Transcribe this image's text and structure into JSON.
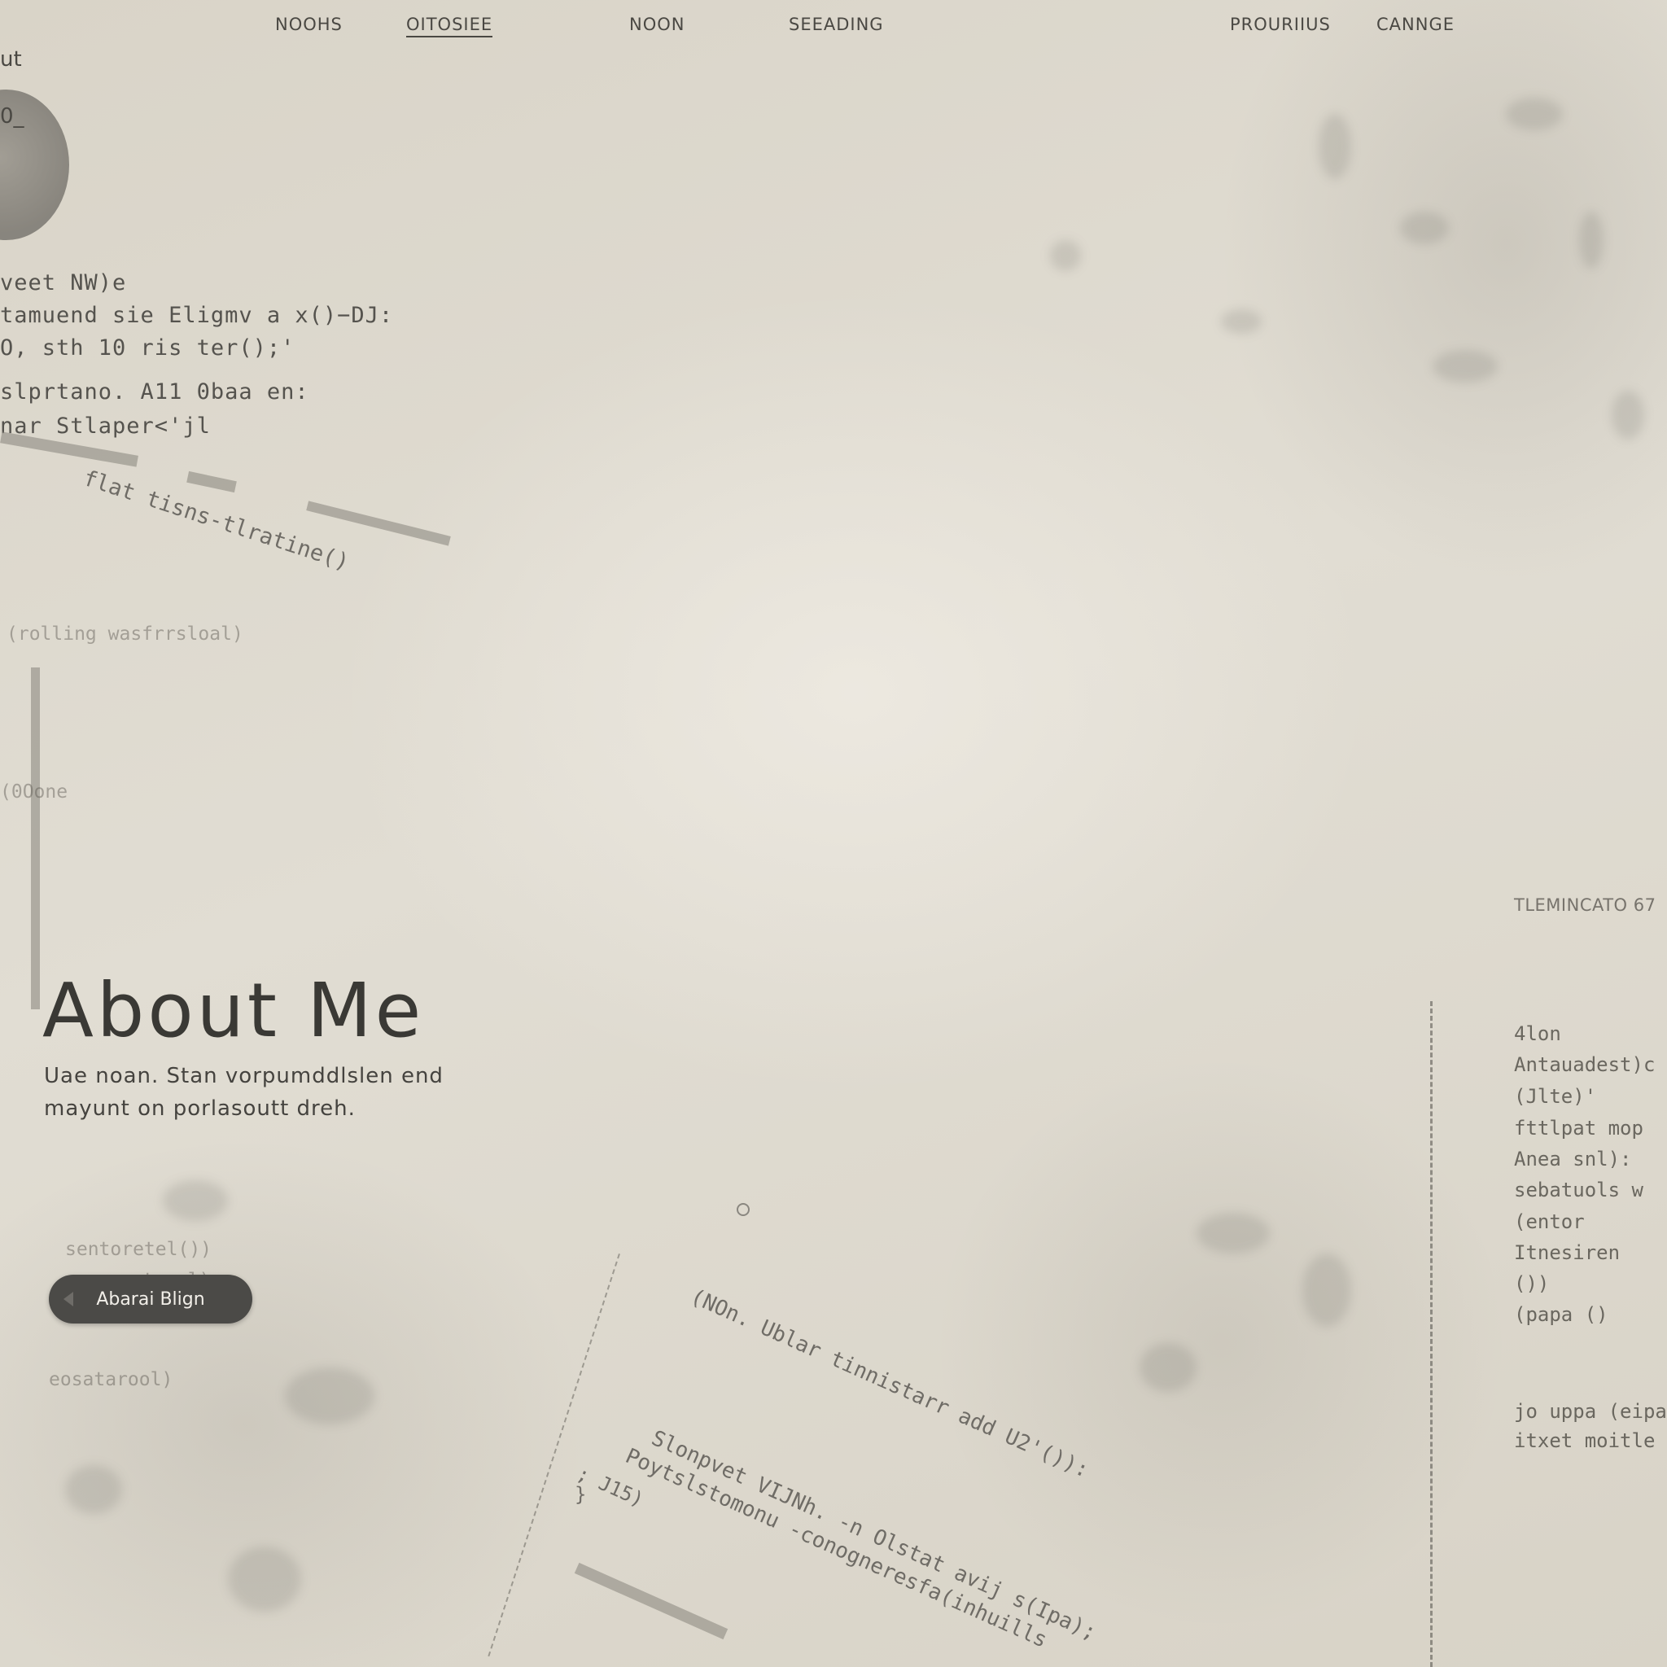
{
  "nav": {
    "items": [
      {
        "label": "NOOHS"
      },
      {
        "label": "OITOSIEE"
      },
      {
        "label": "NOON"
      },
      {
        "label": "SEEADING"
      },
      {
        "label": "PROURIIUS"
      },
      {
        "label": "CANNGE"
      }
    ],
    "active_index": 1
  },
  "left_fragments": {
    "top1": "ut",
    "top2": "0_",
    "code": [
      "veet  NW)e",
      "tamuend sie Eligmv a x()−DJ:",
      "O,  sth 10 ris ter();'",
      "slprtano.  A11 0baa en:",
      "nar  Stlaper<'jl"
    ],
    "rotated": "flat tisns-tlratine()",
    "faint": [
      "(rolling wasfrrsloal)",
      "(0Oone",
      "sentoretel())",
      "eonsteeal)",
      "eosatarool)"
    ]
  },
  "hero": {
    "title": "About Me",
    "subtitle_line1": "Uae noan. Stan vorpumddlslen  end",
    "subtitle_line2": "mayunt on porlasoutt dreh.",
    "button_label": "Abarai Blign"
  },
  "right_panel": {
    "label": "TLEMINCATO 67",
    "code": [
      "4lon",
      "Antauadest)c",
      "(Jlte)'",
      "fttlpat  mop",
      "Anea snl):",
      "sebatuols  w",
      "(entor",
      "Itnesiren",
      "())",
      "(papa  ()",
      "jo uppa (eipar",
      "itxet  moitle"
    ]
  },
  "middle_rotated": {
    "line1": "(NOn. Ublar tinnistarr add U2'()):",
    "line2": "Slonpvet VIJNh. -n Olstat avij s(Ipa);",
    "line3": "Poytslstomonu -conogneresfa(inhuills",
    "line4": "; J15)",
    "line5": "}"
  },
  "colors": {
    "background": "#ddd8cd",
    "text": "#3a3935",
    "button": "#4b4a47"
  }
}
